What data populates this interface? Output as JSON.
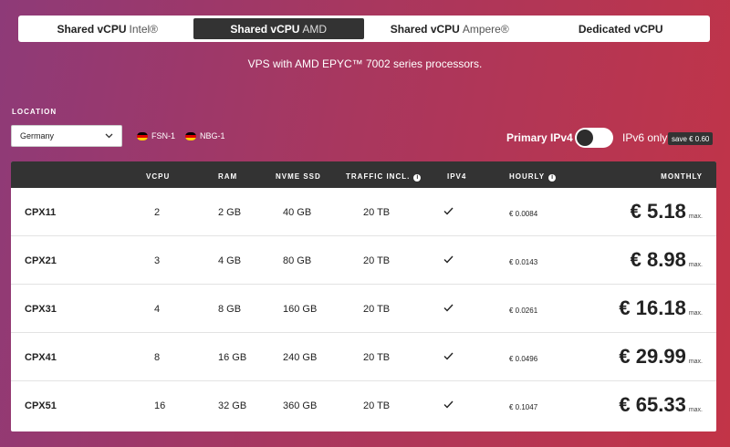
{
  "tabs": [
    {
      "bold": "Shared vCPU",
      "light": "Intel®",
      "active": false
    },
    {
      "bold": "Shared vCPU",
      "light": "AMD",
      "active": true
    },
    {
      "bold": "Shared vCPU",
      "light": "Ampere®",
      "active": false
    },
    {
      "bold": "Dedicated vCPU",
      "light": "",
      "active": false
    }
  ],
  "subtitle": "VPS with AMD EPYC™ 7002 series processors.",
  "location": {
    "label": "LOCATION",
    "selected": "Germany",
    "datacenters": [
      "FSN-1",
      "NBG-1"
    ]
  },
  "ip": {
    "primary_label": "Primary IPv4",
    "ipv6_label": "IPv6 only",
    "save_badge": "save € 0.60",
    "toggle_on": false
  },
  "table": {
    "headers": {
      "vcpu": "VCPU",
      "ram": "RAM",
      "ssd": "NVME SSD",
      "traffic": "TRAFFIC INCL.",
      "ipv4": "IPV4",
      "hourly": "HOURLY",
      "monthly": "MONTHLY"
    },
    "max_label": "max.",
    "rows": [
      {
        "name": "CPX11",
        "vcpu": "2",
        "ram": "2 GB",
        "ssd": "40 GB",
        "traffic": "20 TB",
        "hourly": "€ 0.0084",
        "monthly": "€ 5.18"
      },
      {
        "name": "CPX21",
        "vcpu": "3",
        "ram": "4 GB",
        "ssd": "80 GB",
        "traffic": "20 TB",
        "hourly": "€ 0.0143",
        "monthly": "€ 8.98"
      },
      {
        "name": "CPX31",
        "vcpu": "4",
        "ram": "8 GB",
        "ssd": "160 GB",
        "traffic": "20 TB",
        "hourly": "€ 0.0261",
        "monthly": "€ 16.18"
      },
      {
        "name": "CPX41",
        "vcpu": "8",
        "ram": "16 GB",
        "ssd": "240 GB",
        "traffic": "20 TB",
        "hourly": "€ 0.0496",
        "monthly": "€ 29.99"
      },
      {
        "name": "CPX51",
        "vcpu": "16",
        "ram": "32 GB",
        "ssd": "360 GB",
        "traffic": "20 TB",
        "hourly": "€ 0.1047",
        "monthly": "€ 65.33"
      }
    ]
  }
}
